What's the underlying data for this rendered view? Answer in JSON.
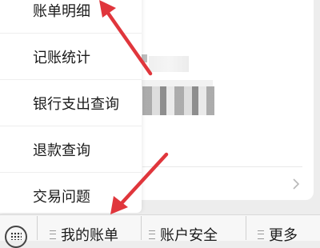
{
  "menu": {
    "items": [
      {
        "label": "账单明细"
      },
      {
        "label": "记账统计"
      },
      {
        "label": "银行支出查询"
      },
      {
        "label": "退款查询"
      },
      {
        "label": "交易问题"
      }
    ]
  },
  "bottom_bar": {
    "tabs": [
      {
        "label": "我的账单"
      },
      {
        "label": "账户安全"
      },
      {
        "label": "更多"
      }
    ]
  },
  "colors": {
    "arrow": "#e0363c",
    "menu_background": "#ffffff",
    "page_background": "#ededed"
  },
  "icons": {
    "keyboard": "keyboard-icon",
    "chevron": "chevron-right-icon",
    "tab_menu": "menu-lines-icon"
  }
}
